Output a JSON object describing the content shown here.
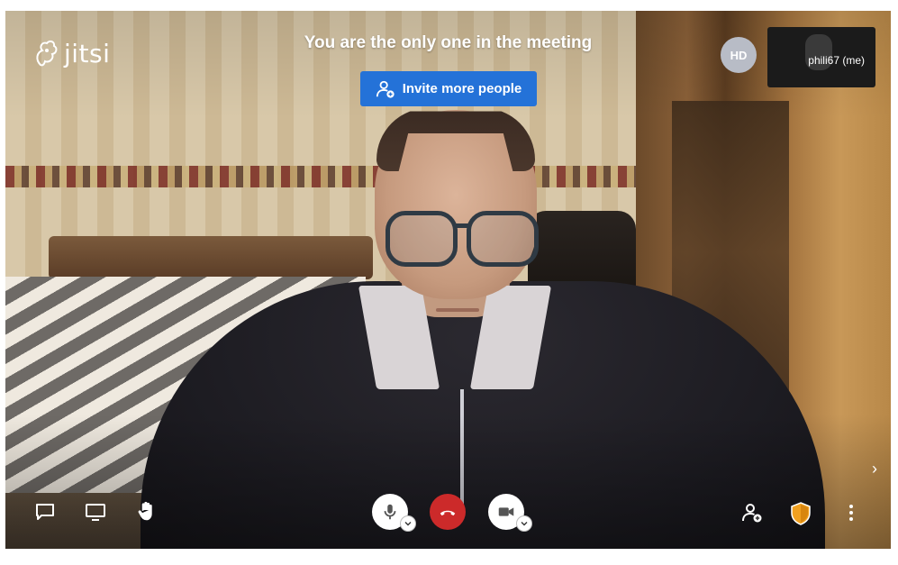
{
  "app": {
    "logo_text": "jitsi"
  },
  "notice": {
    "text": "You are the only one in the meeting"
  },
  "invite": {
    "label": "Invite more people"
  },
  "participants": {
    "remote_avatar_initials": "HD",
    "self_name": "phili67 (me)"
  },
  "toolbar": {
    "left": [
      "chat-icon",
      "screenshare-icon",
      "raise-hand-icon"
    ],
    "center": [
      "microphone-icon",
      "hangup-icon",
      "camera-icon"
    ],
    "right": [
      "invite-icon",
      "security-shield-icon",
      "more-options-icon"
    ]
  },
  "colors": {
    "invite_button": "#2472d8",
    "hangup": "#cc2a2a",
    "shield": "#f0a020"
  }
}
